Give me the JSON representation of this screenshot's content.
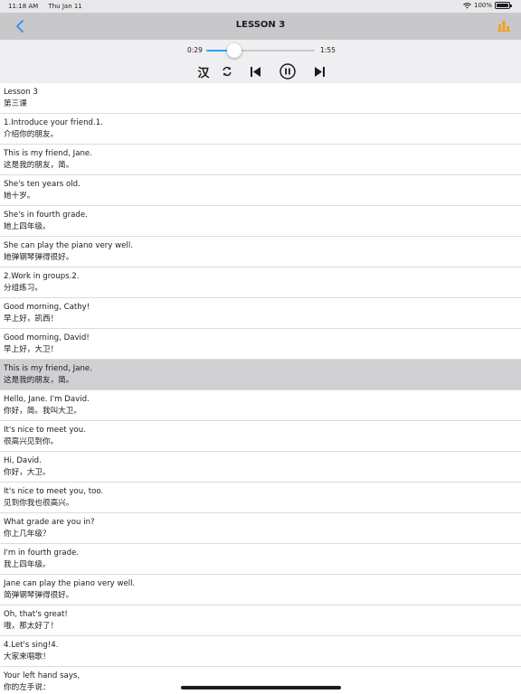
{
  "status": {
    "time": "11:18 AM",
    "date": "Thu Jan 11",
    "battery": "100%"
  },
  "nav": {
    "title": "LESSON 3"
  },
  "player": {
    "current": "0:29",
    "total": "1:55",
    "progress": 0.26,
    "han_label": "汉",
    "state": "playing"
  },
  "colors": {
    "accent": "#2aa7f0",
    "chart_icon": "#f0a020",
    "highlight": "#d0d0d3"
  },
  "rows": [
    {
      "en": "Lesson 3",
      "cn": "第三课"
    },
    {
      "en": "1.Introduce your friend.1.",
      "cn": "介绍你的朋友。"
    },
    {
      "en": "This is my friend, Jane.",
      "cn": "这是我的朋友，简。"
    },
    {
      "en": "She's ten years old.",
      "cn": "她十岁。"
    },
    {
      "en": "She's in fourth grade.",
      "cn": "她上四年级。"
    },
    {
      "en": "She can play the piano very well.",
      "cn": "她弹钢琴弹得很好。"
    },
    {
      "en": "2.Work in groups.2.",
      "cn": "分组练习。"
    },
    {
      "en": "Good morning, Cathy!",
      "cn": "早上好，凯西！"
    },
    {
      "en": "Good morning, David!",
      "cn": "早上好，大卫！"
    },
    {
      "en": "This is my friend, Jane.",
      "cn": "这是我的朋友，简。",
      "active": true
    },
    {
      "en": "Hello, Jane. I'm David.",
      "cn": "你好，简。我叫大卫。"
    },
    {
      "en": "It's nice to meet you.",
      "cn": "很高兴见到你。"
    },
    {
      "en": "Hi, David.",
      "cn": "你好，大卫。"
    },
    {
      "en": "It's nice to meet you, too.",
      "cn": "见到你我也很高兴。"
    },
    {
      "en": "What grade are you in?",
      "cn": "你上几年级？"
    },
    {
      "en": "I'm in fourth grade.",
      "cn": "我上四年级。"
    },
    {
      "en": "Jane can play the piano very well.",
      "cn": "简弹钢琴弹得很好。"
    },
    {
      "en": "Oh, that's great!",
      "cn": "哦，那太好了！"
    },
    {
      "en": "4.Let's sing!4.",
      "cn": "大家来唱歌！"
    },
    {
      "en": "Your left hand says,",
      "cn": "你的左手说："
    }
  ]
}
